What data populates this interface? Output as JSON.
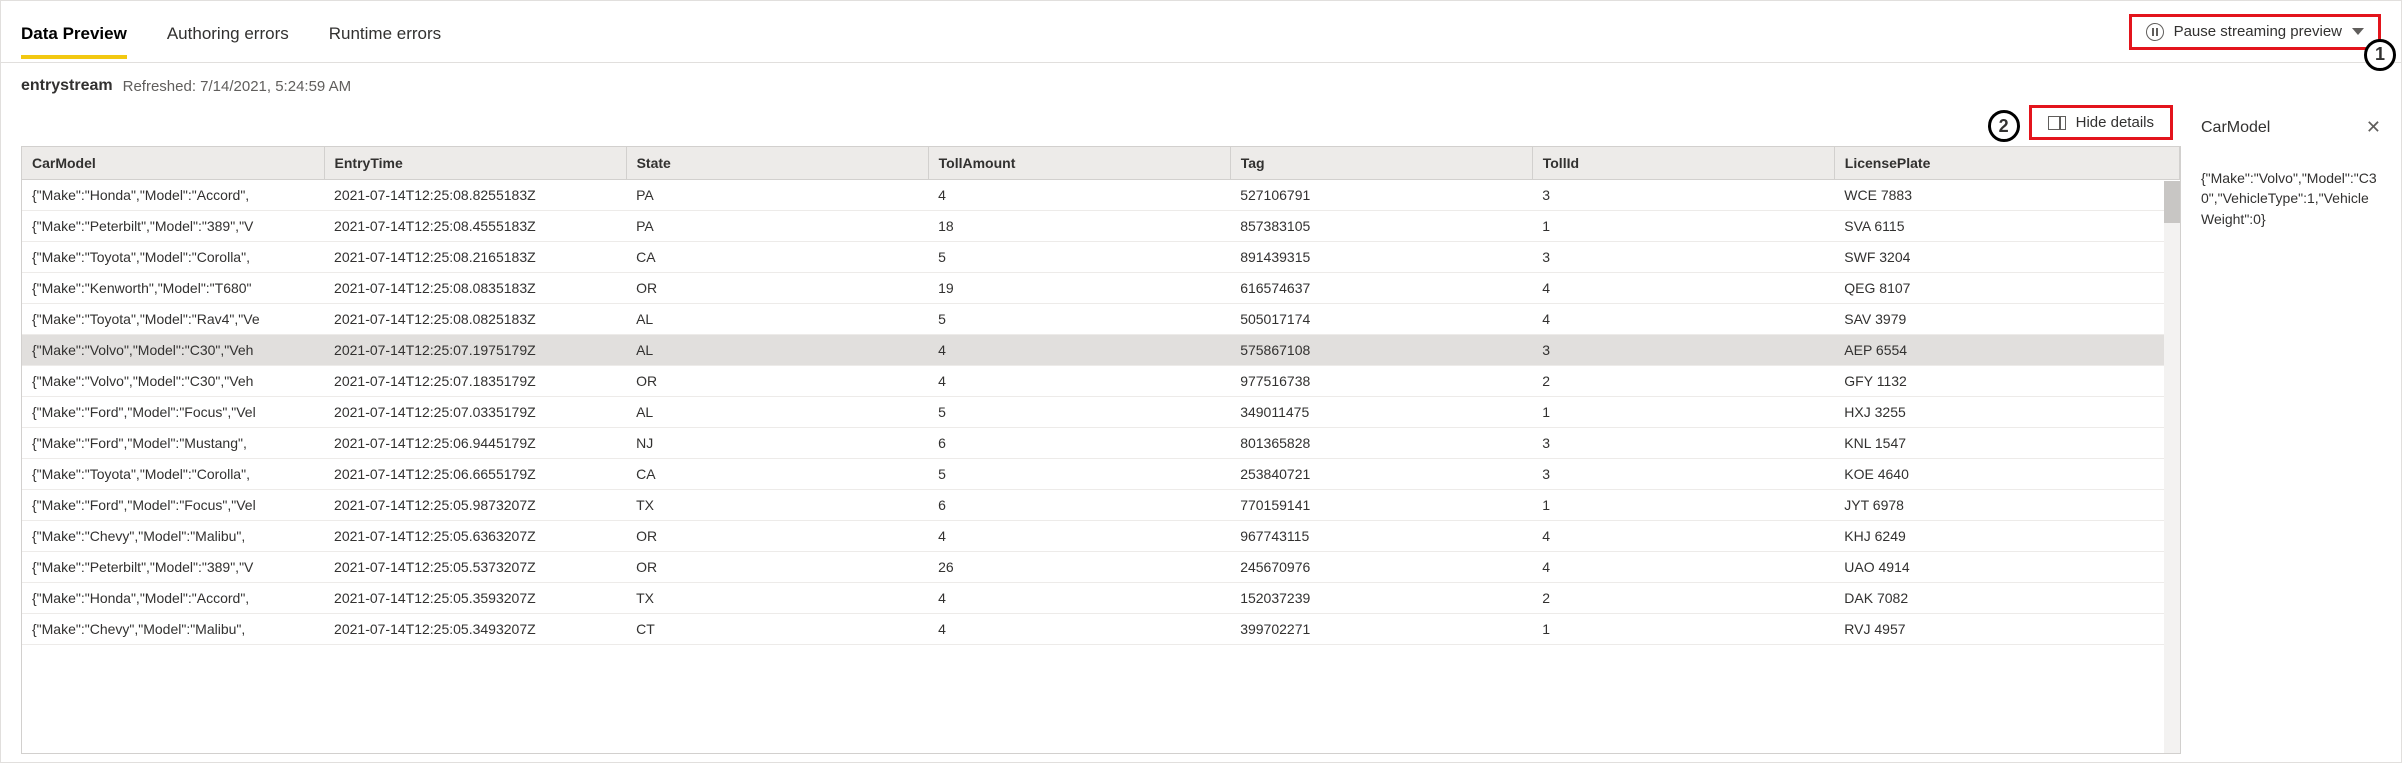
{
  "tabs": {
    "data_preview": "Data Preview",
    "authoring_errors": "Authoring errors",
    "runtime_errors": "Runtime errors"
  },
  "pause_label": "Pause streaming preview",
  "callouts": {
    "one": "1",
    "two": "2"
  },
  "stream": {
    "name": "entrystream",
    "refreshed": "Refreshed: 7/14/2021, 5:24:59 AM"
  },
  "hide_details_label": "Hide details",
  "columns": {
    "car_model": "CarModel",
    "entry_time": "EntryTime",
    "state": "State",
    "toll_amount": "TollAmount",
    "tag": "Tag",
    "toll_id": "TollId",
    "license_plate": "LicensePlate"
  },
  "rows": [
    {
      "car": "{\"Make\":\"Honda\",\"Model\":\"Accord\",",
      "time": "2021-07-14T12:25:08.8255183Z",
      "state": "PA",
      "amount": "4",
      "tag": "527106791",
      "tollid": "3",
      "plate": "WCE 7883"
    },
    {
      "car": "{\"Make\":\"Peterbilt\",\"Model\":\"389\",\"V",
      "time": "2021-07-14T12:25:08.4555183Z",
      "state": "PA",
      "amount": "18",
      "tag": "857383105",
      "tollid": "1",
      "plate": "SVA 6115"
    },
    {
      "car": "{\"Make\":\"Toyota\",\"Model\":\"Corolla\",",
      "time": "2021-07-14T12:25:08.2165183Z",
      "state": "CA",
      "amount": "5",
      "tag": "891439315",
      "tollid": "3",
      "plate": "SWF 3204"
    },
    {
      "car": "{\"Make\":\"Kenworth\",\"Model\":\"T680\"",
      "time": "2021-07-14T12:25:08.0835183Z",
      "state": "OR",
      "amount": "19",
      "tag": "616574637",
      "tollid": "4",
      "plate": "QEG 8107"
    },
    {
      "car": "{\"Make\":\"Toyota\",\"Model\":\"Rav4\",\"Ve",
      "time": "2021-07-14T12:25:08.0825183Z",
      "state": "AL",
      "amount": "5",
      "tag": "505017174",
      "tollid": "4",
      "plate": "SAV 3979"
    },
    {
      "car": "{\"Make\":\"Volvo\",\"Model\":\"C30\",\"Veh",
      "time": "2021-07-14T12:25:07.1975179Z",
      "state": "AL",
      "amount": "4",
      "tag": "575867108",
      "tollid": "3",
      "plate": "AEP 6554",
      "selected": true
    },
    {
      "car": "{\"Make\":\"Volvo\",\"Model\":\"C30\",\"Veh",
      "time": "2021-07-14T12:25:07.1835179Z",
      "state": "OR",
      "amount": "4",
      "tag": "977516738",
      "tollid": "2",
      "plate": "GFY 1132"
    },
    {
      "car": "{\"Make\":\"Ford\",\"Model\":\"Focus\",\"Vel",
      "time": "2021-07-14T12:25:07.0335179Z",
      "state": "AL",
      "amount": "5",
      "tag": "349011475",
      "tollid": "1",
      "plate": "HXJ 3255"
    },
    {
      "car": "{\"Make\":\"Ford\",\"Model\":\"Mustang\",",
      "time": "2021-07-14T12:25:06.9445179Z",
      "state": "NJ",
      "amount": "6",
      "tag": "801365828",
      "tollid": "3",
      "plate": "KNL 1547"
    },
    {
      "car": "{\"Make\":\"Toyota\",\"Model\":\"Corolla\",",
      "time": "2021-07-14T12:25:06.6655179Z",
      "state": "CA",
      "amount": "5",
      "tag": "253840721",
      "tollid": "3",
      "plate": "KOE 4640"
    },
    {
      "car": "{\"Make\":\"Ford\",\"Model\":\"Focus\",\"Vel",
      "time": "2021-07-14T12:25:05.9873207Z",
      "state": "TX",
      "amount": "6",
      "tag": "770159141",
      "tollid": "1",
      "plate": "JYT 6978"
    },
    {
      "car": "{\"Make\":\"Chevy\",\"Model\":\"Malibu\",",
      "time": "2021-07-14T12:25:05.6363207Z",
      "state": "OR",
      "amount": "4",
      "tag": "967743115",
      "tollid": "4",
      "plate": "KHJ 6249"
    },
    {
      "car": "{\"Make\":\"Peterbilt\",\"Model\":\"389\",\"V",
      "time": "2021-07-14T12:25:05.5373207Z",
      "state": "OR",
      "amount": "26",
      "tag": "245670976",
      "tollid": "4",
      "plate": "UAO 4914"
    },
    {
      "car": "{\"Make\":\"Honda\",\"Model\":\"Accord\",",
      "time": "2021-07-14T12:25:05.3593207Z",
      "state": "TX",
      "amount": "4",
      "tag": "152037239",
      "tollid": "2",
      "plate": "DAK 7082"
    },
    {
      "car": "{\"Make\":\"Chevy\",\"Model\":\"Malibu\",",
      "time": "2021-07-14T12:25:05.3493207Z",
      "state": "CT",
      "amount": "4",
      "tag": "399702271",
      "tollid": "1",
      "plate": "RVJ 4957"
    }
  ],
  "detail": {
    "title": "CarModel",
    "body": "{\"Make\":\"Volvo\",\"Model\":\"C30\",\"VehicleType\":1,\"VehicleWeight\":0}"
  }
}
